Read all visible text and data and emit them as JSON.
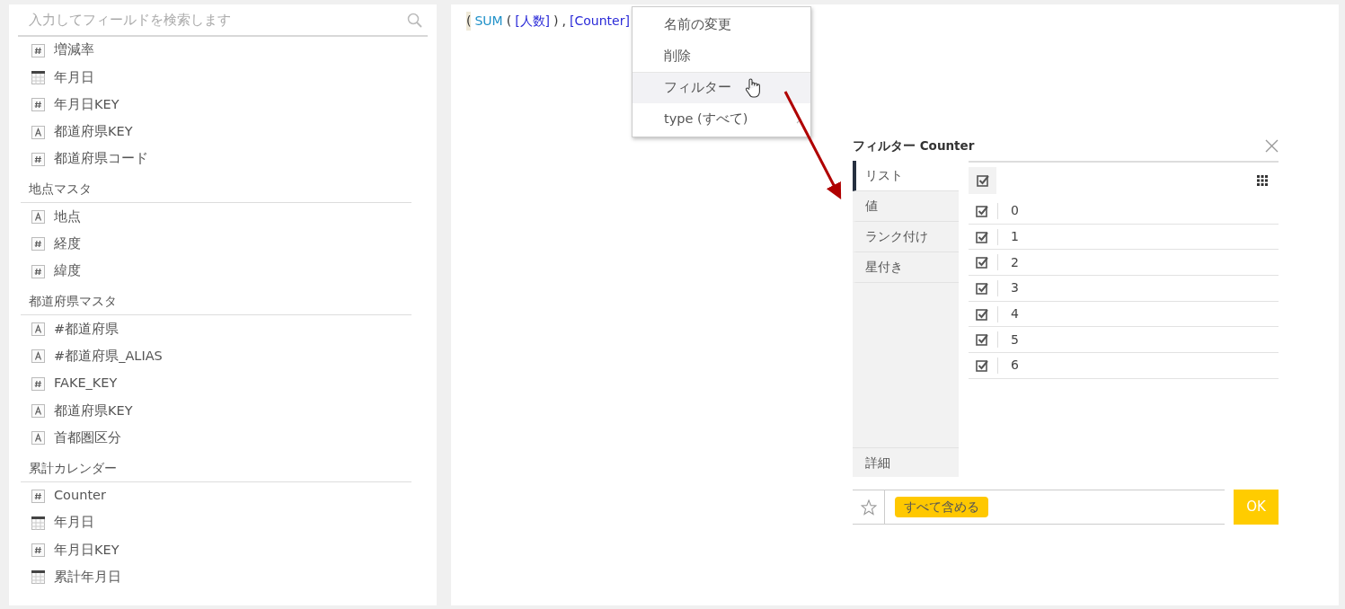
{
  "search": {
    "placeholder": "入力してフィールドを検索します"
  },
  "field_groups": [
    {
      "fields": [
        {
          "kind": "number",
          "label": "増減率"
        },
        {
          "kind": "date",
          "label": "年月日"
        },
        {
          "kind": "number",
          "label": "年月日KEY"
        },
        {
          "kind": "text",
          "label": "都道府県KEY"
        },
        {
          "kind": "number",
          "label": "都道府県コード"
        }
      ]
    },
    {
      "title": "地点マスタ",
      "fields": [
        {
          "kind": "text",
          "label": "地点"
        },
        {
          "kind": "number",
          "label": "経度"
        },
        {
          "kind": "number",
          "label": "緯度"
        }
      ]
    },
    {
      "title": "都道府県マスタ",
      "fields": [
        {
          "kind": "text",
          "label": "#都道府県"
        },
        {
          "kind": "text",
          "label": "#都道府県_ALIAS"
        },
        {
          "kind": "number",
          "label": "FAKE_KEY"
        },
        {
          "kind": "text",
          "label": "都道府県KEY"
        },
        {
          "kind": "text",
          "label": "首都圏区分"
        }
      ]
    },
    {
      "title": "累計カレンダー",
      "fields": [
        {
          "kind": "number",
          "label": "Counter"
        },
        {
          "kind": "date",
          "label": "年月日"
        },
        {
          "kind": "number",
          "label": "年月日KEY"
        },
        {
          "kind": "date",
          "label": "累計年月日"
        }
      ]
    }
  ],
  "formula": [
    {
      "kind": "bracket",
      "text": "("
    },
    {
      "kind": "function",
      "text": "SUM"
    },
    {
      "kind": "punct",
      "text": "("
    },
    {
      "kind": "field",
      "text": "[人数]"
    },
    {
      "kind": "punct",
      "text": ")"
    },
    {
      "kind": "punct",
      "text": ","
    },
    {
      "kind": "field",
      "text": "[Counter]"
    }
  ],
  "context_menu": {
    "items": [
      {
        "label": "名前の変更",
        "selected": false,
        "submenu": false
      },
      {
        "label": "削除",
        "selected": false,
        "submenu": false
      },
      {
        "label": "フィルター",
        "selected": true,
        "submenu": false
      },
      {
        "label": "type (すべて)",
        "selected": false,
        "submenu": true
      }
    ]
  },
  "filter_dialog": {
    "title": "フィルター Counter",
    "tabs": [
      {
        "label": "リスト",
        "selected": true
      },
      {
        "label": "値",
        "selected": false
      },
      {
        "label": "ランク付け",
        "selected": false
      },
      {
        "label": "星付き",
        "selected": false
      }
    ],
    "detail_tab": {
      "label": "詳細",
      "selected": false
    },
    "select_all": {
      "checked": true
    },
    "values": [
      {
        "label": "0",
        "checked": true
      },
      {
        "label": "1",
        "checked": true
      },
      {
        "label": "2",
        "checked": true
      },
      {
        "label": "3",
        "checked": true
      },
      {
        "label": "4",
        "checked": true
      },
      {
        "label": "5",
        "checked": true
      },
      {
        "label": "6",
        "checked": true
      }
    ],
    "starred": false,
    "summary_chip": "すべて含める",
    "ok_button": "OK"
  }
}
